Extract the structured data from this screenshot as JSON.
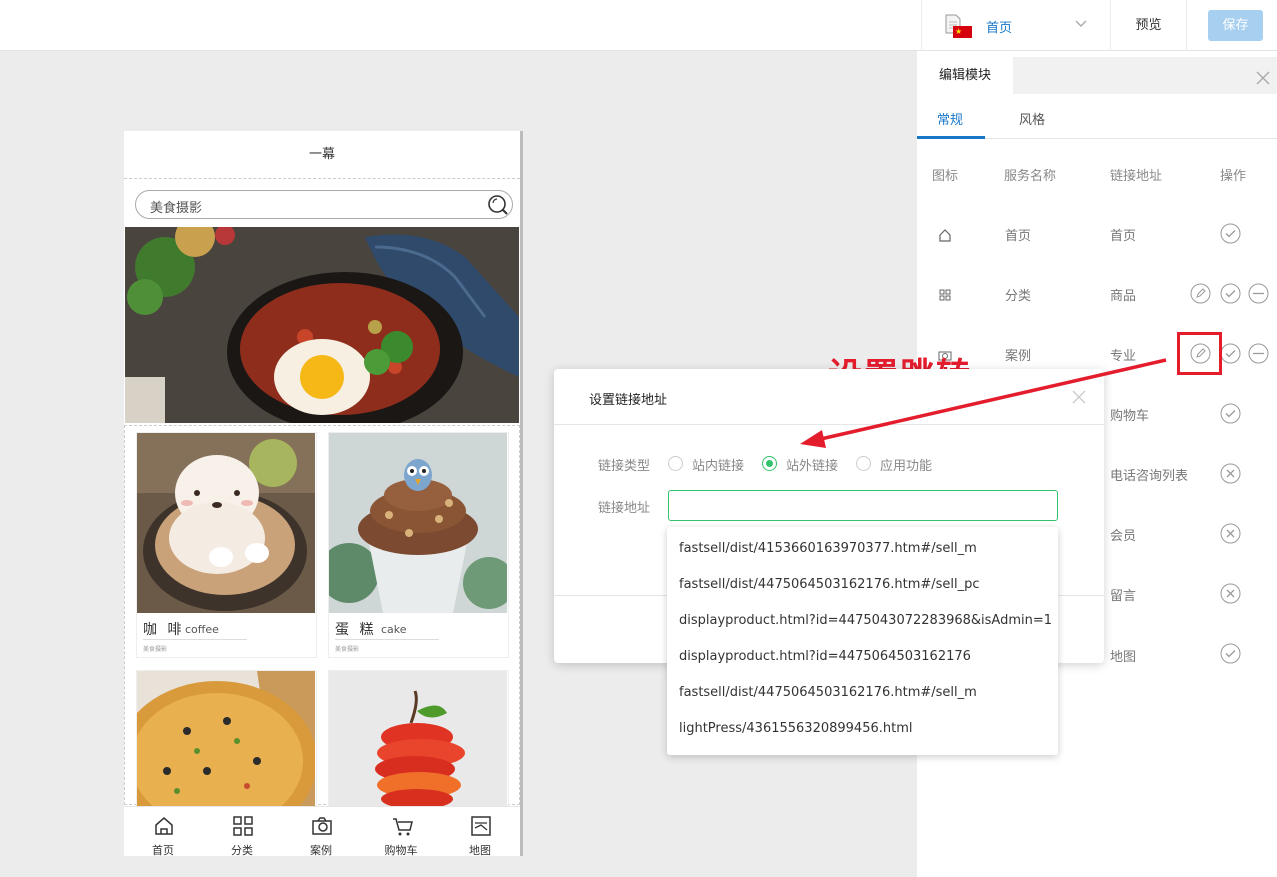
{
  "topbar": {
    "page_selector": "首页",
    "preview_label": "预览",
    "save_label": "保存"
  },
  "phone": {
    "title": "一幕",
    "search_placeholder": "美食摄影",
    "cards": [
      {
        "name": "咖 啡",
        "en": "coffee",
        "sub": "美食摄影"
      },
      {
        "name": "蛋 糕",
        "en": "cake",
        "sub": "美食摄影"
      }
    ],
    "nav": [
      "首页",
      "分类",
      "案例",
      "购物车",
      "地图"
    ]
  },
  "panel": {
    "tab_title": "编辑模块",
    "subtabs": [
      "常规",
      "风格"
    ],
    "headers": {
      "icon": "图标",
      "name": "服务名称",
      "link": "链接地址",
      "ops": "操作"
    },
    "rows": [
      {
        "name": "首页",
        "link": "首页",
        "icon": "home-icon"
      },
      {
        "name": "分类",
        "link": "商品",
        "icon": "grid-icon"
      },
      {
        "name": "案例",
        "link": "专业",
        "icon": "camera-icon"
      },
      {
        "name": "",
        "link": "购物车",
        "icon": ""
      },
      {
        "name": "",
        "link": "电话咨询列表",
        "icon": ""
      },
      {
        "name": "",
        "link": "会员",
        "icon": ""
      },
      {
        "name": "",
        "link": "留言",
        "icon": ""
      },
      {
        "name": "",
        "link": "地图",
        "icon": ""
      }
    ]
  },
  "annotation": {
    "text": "设置跳转",
    "color": "#e41d2d"
  },
  "dialog": {
    "title": "设置链接地址",
    "type_label": "链接类型",
    "options": [
      "站内链接",
      "站外链接",
      "应用功能"
    ],
    "selected_option": "站外链接",
    "address_label": "链接地址",
    "address_value": "",
    "suggestions": [
      "fastsell/dist/4153660163970377.htm#/sell_m",
      "fastsell/dist/4475064503162176.htm#/sell_pc",
      "displayproduct.html?id=4475043072283968&isAdmin=1",
      "displayproduct.html?id=4475064503162176",
      "fastsell/dist/4475064503162176.htm#/sell_m",
      "lightPress/4361556320899456.html"
    ]
  },
  "colors": {
    "accent": "#1677c9",
    "green": "#32c36c",
    "save_button": "#a7cff0"
  }
}
